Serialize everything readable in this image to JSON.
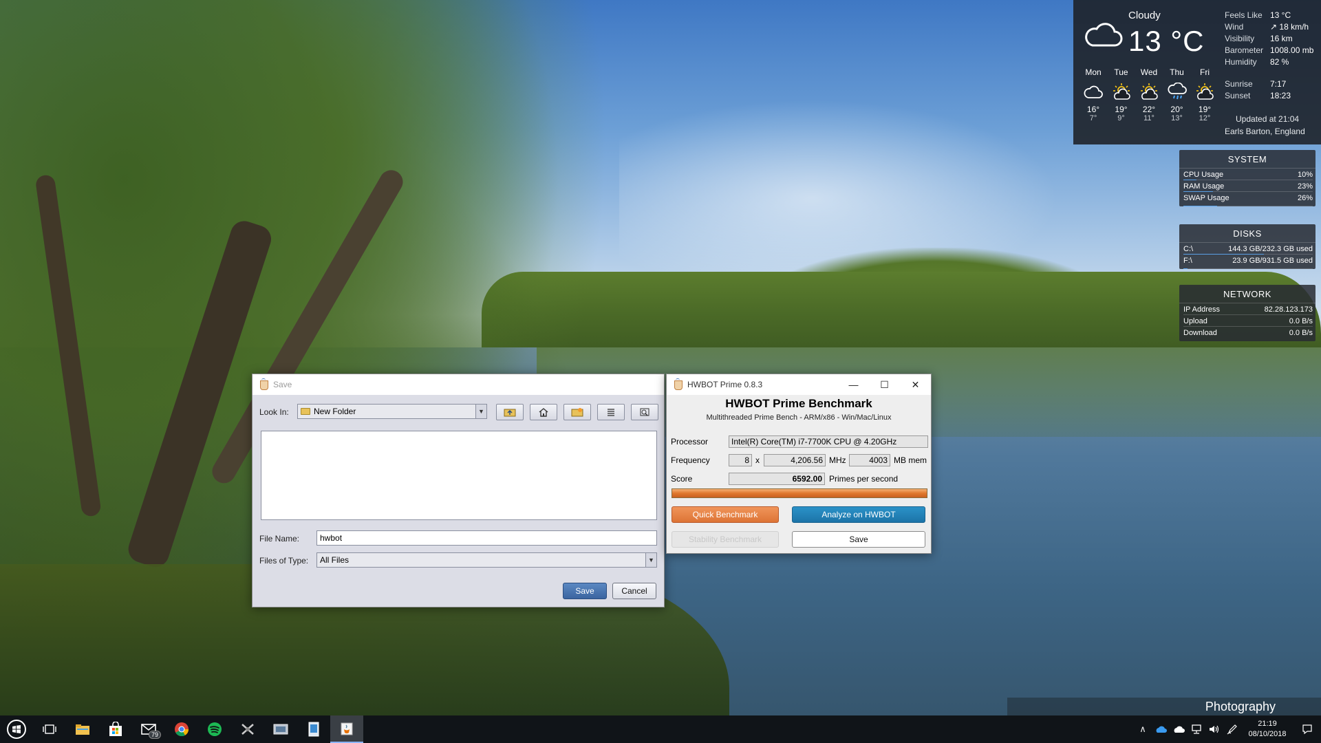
{
  "weather": {
    "condition": "Cloudy",
    "temperature": "13 °C",
    "details": [
      {
        "label": "Feels Like",
        "value": "13 °C"
      },
      {
        "label": "Wind",
        "value": "↗ 18 km/h"
      },
      {
        "label": "Visibility",
        "value": "16 km"
      },
      {
        "label": "Barometer",
        "value": "1008.00 mb"
      },
      {
        "label": "Humidity",
        "value": "82 %"
      }
    ],
    "forecast": [
      {
        "day": "Mon",
        "hi": "16°",
        "lo": "7°",
        "icon": "cloud-icon"
      },
      {
        "day": "Tue",
        "hi": "19°",
        "lo": "9°",
        "icon": "partly-sunny-icon"
      },
      {
        "day": "Wed",
        "hi": "22°",
        "lo": "11°",
        "icon": "partly-sunny-icon"
      },
      {
        "day": "Thu",
        "hi": "20°",
        "lo": "13°",
        "icon": "rain-icon"
      },
      {
        "day": "Fri",
        "hi": "19°",
        "lo": "12°",
        "icon": "partly-sunny-icon"
      }
    ],
    "sunrise_label": "Sunrise",
    "sunrise": "7:17",
    "sunset_label": "Sunset",
    "sunset": "18:23",
    "updated": "Updated at 21:04",
    "location": "Earls Barton, England"
  },
  "system": {
    "title": "SYSTEM",
    "rows": [
      {
        "label": "CPU Usage",
        "value": "10%",
        "fill": 0.1
      },
      {
        "label": "RAM Usage",
        "value": "23%",
        "fill": 0.23
      },
      {
        "label": "SWAP Usage",
        "value": "26%",
        "fill": 0.26
      }
    ]
  },
  "disks": {
    "title": "DISKS",
    "rows": [
      {
        "label": "C:\\",
        "value": "144.3 GB/232.3 GB used",
        "fill": 0.62
      },
      {
        "label": "F:\\",
        "value": "23.9 GB/931.5 GB used",
        "fill": 0.03
      }
    ]
  },
  "network": {
    "title": "NETWORK",
    "rows": [
      {
        "label": "IP Address",
        "value": "82.28.123.173"
      },
      {
        "label": "Upload",
        "value": "0.0 B/s"
      },
      {
        "label": "Download",
        "value": "0.0 B/s"
      }
    ]
  },
  "save_dialog": {
    "title": "Save",
    "look_in_label": "Look In:",
    "look_in_value": "New Folder",
    "toolbar_icons": [
      "up-folder-icon",
      "home-icon",
      "new-folder-icon",
      "list-view-icon",
      "details-view-icon"
    ],
    "file_name_label": "File Name:",
    "file_name_value": "hwbot",
    "files_of_type_label": "Files of Type:",
    "files_of_type_value": "All Files",
    "save_label": "Save",
    "cancel_label": "Cancel"
  },
  "hwbot": {
    "window_title": "HWBOT Prime 0.8.3",
    "heading": "HWBOT Prime Benchmark",
    "subheading": "Multithreaded Prime Bench - ARM/x86 - Win/Mac/Linux",
    "processor_label": "Processor",
    "processor_value": "Intel(R) Core(TM) i7-7700K CPU @ 4.20GHz",
    "frequency_label": "Frequency",
    "cores": "8",
    "times": "x",
    "mhz_value": "4,206.56",
    "mhz_unit": "MHz",
    "mem_value": "4003",
    "mem_unit": "MB mem",
    "score_label": "Score",
    "score_value": "6592.00",
    "score_unit": "Primes per second",
    "progress": 1.0,
    "quick_label": "Quick Benchmark",
    "analyze_label": "Analyze on HWBOT",
    "stability_label": "Stability Benchmark",
    "save_label": "Save"
  },
  "photography_label": "Photography",
  "taskbar": {
    "items": [
      "start-icon",
      "task-view-icon",
      "file-explorer-icon",
      "store-icon",
      "mail-icon",
      "chrome-icon",
      "spotify-icon",
      "app-icon",
      "app2-icon",
      "app3-icon",
      "java-icon"
    ],
    "mail_badge": "79",
    "time": "21:19",
    "date": "08/10/2018"
  }
}
